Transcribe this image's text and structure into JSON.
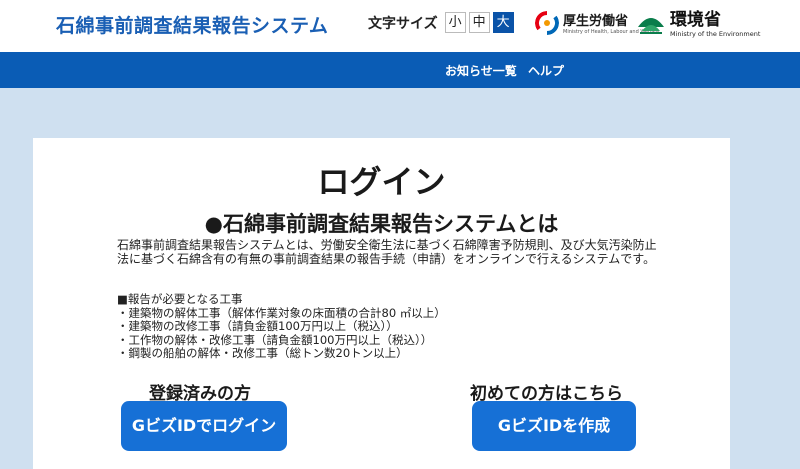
{
  "header": {
    "app_title": "石綿事前調査結果報告システム",
    "font_size": {
      "label": "文字サイズ",
      "small": "小",
      "medium": "中",
      "large": "大",
      "selected": "大"
    },
    "mhlw_logo": {
      "name": "厚生労働省",
      "subtitle": "Ministry of Health, Labour and Welfare"
    },
    "env_logo": {
      "name": "環境省",
      "subtitle": "Ministry of the Environment"
    }
  },
  "nav": {
    "items": [
      "お知らせ一覧",
      "ヘルプ"
    ]
  },
  "main": {
    "login_heading": "ログイン",
    "about_heading": "●石綿事前調査結果報告システムとは",
    "description": "石綿事前調査結果報告システムとは、労働安全衛生法に基づく石綿障害予防規則、及び大気汚染防止法に基づく石綿含有の有無の事前調査結果の報告手続（申請）をオンラインで行えるシステムです。",
    "works_title": "■報告が必要となる工事",
    "works": [
      "・建築物の解体工事（解体作業対象の床面積の合計80 ㎡以上）",
      "・建築物の改修工事（請負金額100万円以上（税込））",
      "・工作物の解体・改修工事（請負金額100万円以上（税込））",
      "・鋼製の船舶の解体・改修工事（総トン数20トン以上）"
    ],
    "registered_label": "登録済みの方",
    "registered_button": "GビズIDでログイン",
    "first_label": "初めての方はこちら",
    "first_button": "GビズIDを作成"
  },
  "colors": {
    "brand_blue": "#0a5cb5",
    "button_blue": "#1670d6",
    "background": "#cfe0f0"
  }
}
